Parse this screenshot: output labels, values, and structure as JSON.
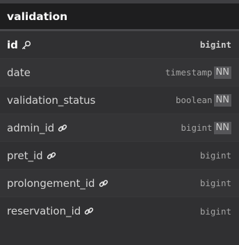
{
  "table": {
    "name": "validation",
    "columns": [
      {
        "name": "id",
        "type": "bigint",
        "primary_key": true,
        "icon": "key-icon",
        "not_null": false
      },
      {
        "name": "date",
        "type": "timestamp",
        "primary_key": false,
        "icon": null,
        "not_null": true,
        "badge": "NN"
      },
      {
        "name": "validation_status",
        "type": "boolean",
        "primary_key": false,
        "icon": null,
        "not_null": true,
        "badge": "NN"
      },
      {
        "name": "admin_id",
        "type": "bigint",
        "primary_key": false,
        "icon": "link-icon",
        "not_null": true,
        "badge": "NN"
      },
      {
        "name": "pret_id",
        "type": "bigint",
        "primary_key": false,
        "icon": "link-icon",
        "not_null": false
      },
      {
        "name": "prolongement_id",
        "type": "bigint",
        "primary_key": false,
        "icon": "link-icon",
        "not_null": false
      },
      {
        "name": "reservation_id",
        "type": "bigint",
        "primary_key": false,
        "icon": "link-icon",
        "not_null": false
      }
    ]
  },
  "colors": {
    "header_bg": "#1e1e1f",
    "body_bg": "#303032",
    "badge_bg": "#565659"
  }
}
